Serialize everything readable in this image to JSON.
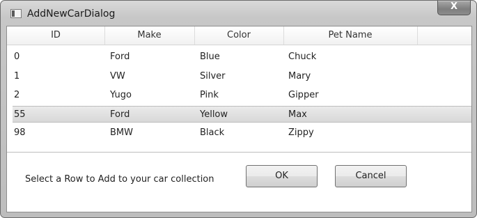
{
  "window": {
    "title": "AddNewCarDialog",
    "close_label": "X"
  },
  "grid": {
    "columns": [
      "ID",
      "Make",
      "Color",
      "Pet Name"
    ],
    "rows": [
      {
        "id": "0",
        "make": "Ford",
        "color": "Blue",
        "pet_name": "Chuck"
      },
      {
        "id": "1",
        "make": "VW",
        "color": "Silver",
        "pet_name": "Mary"
      },
      {
        "id": "2",
        "make": "Yugo",
        "color": "Pink",
        "pet_name": "Gipper"
      },
      {
        "id": "55",
        "make": "Ford",
        "color": "Yellow",
        "pet_name": "Max"
      },
      {
        "id": "98",
        "make": "BMW",
        "color": "Black",
        "pet_name": "Zippy"
      }
    ],
    "selected_row_index": 3
  },
  "footer": {
    "instruction": "Select a Row to Add to your car collection",
    "ok_label": "OK",
    "cancel_label": "Cancel"
  },
  "colors": {
    "selected_row": "#dedede",
    "window_frame": "#c7c7c7"
  },
  "icons": {
    "app": "window-app-icon",
    "close": "close-icon"
  }
}
